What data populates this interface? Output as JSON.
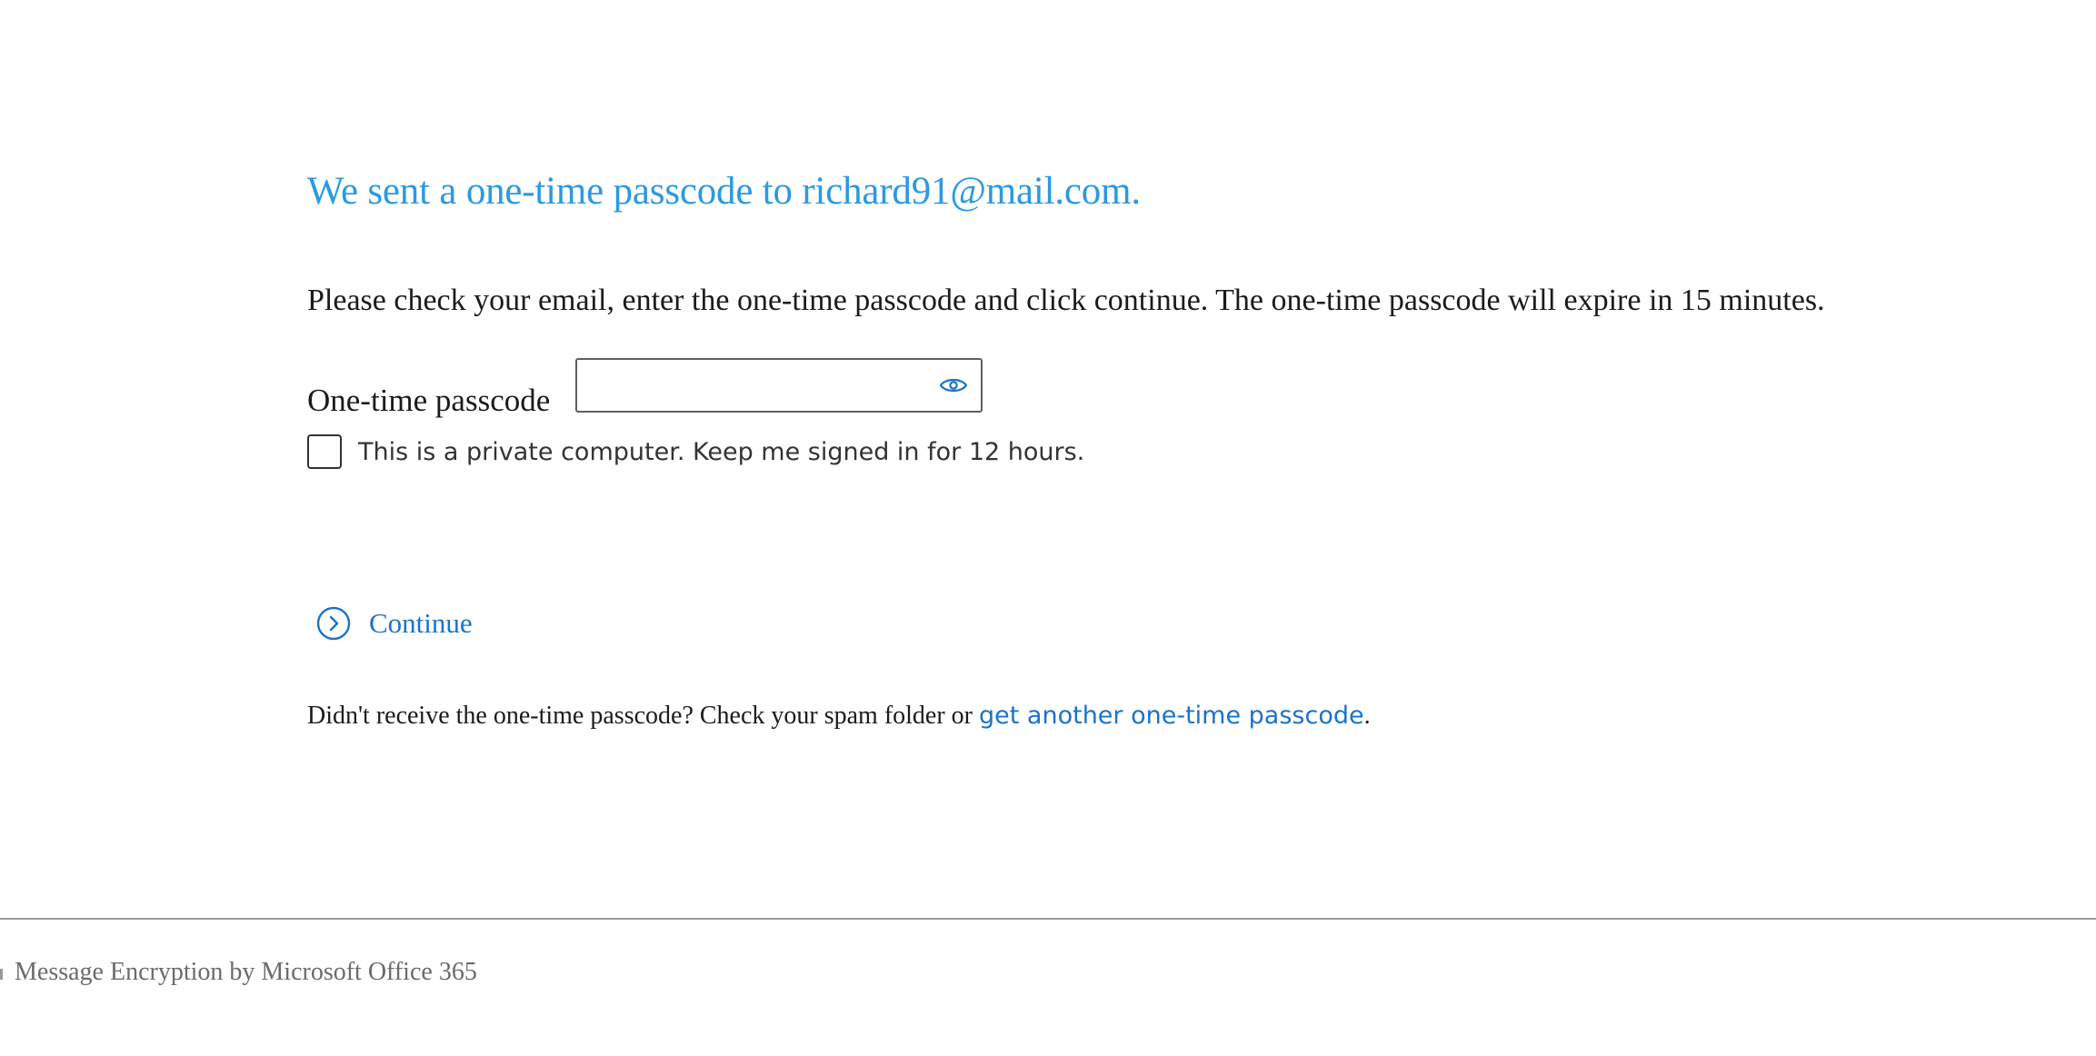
{
  "header": {
    "title": "We sent a one-time passcode to richard91@mail.com."
  },
  "instructions": "Please check your email, enter the one-time passcode and click continue. The one-time passcode will expire in 15 minutes.",
  "passcode": {
    "label": "One-time passcode",
    "value": "",
    "placeholder": "",
    "reveal_icon": "eye-icon"
  },
  "keep_signed_in": {
    "label": "This is a private computer. Keep me signed in for 12 hours.",
    "checked": false
  },
  "continue_button": {
    "label": "Continue",
    "icon": "chevron-right-circle-icon"
  },
  "resend": {
    "prefix": "Didn't receive the one-time passcode? Check your spam folder or ",
    "link_label": "get another one-time passcode",
    "suffix": "."
  },
  "footer": {
    "text": "Message Encryption by Microsoft Office 365"
  },
  "colors": {
    "heading": "#2b9ae0",
    "link": "#1a73c9",
    "footer_text": "#6b6b6b"
  }
}
